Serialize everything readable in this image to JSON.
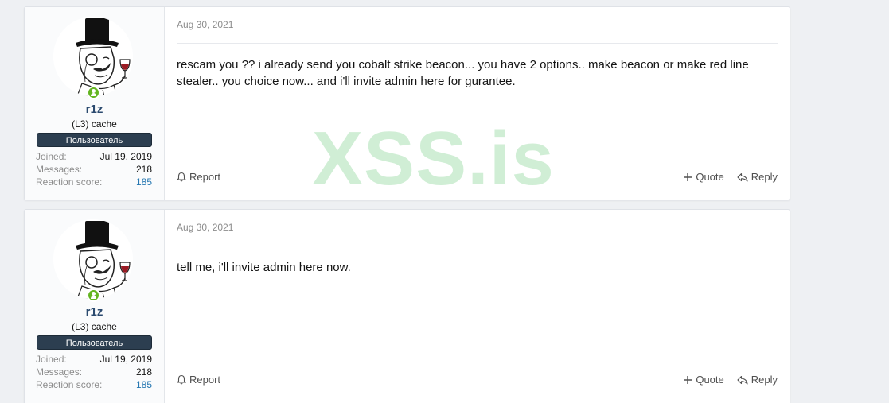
{
  "watermark": "XSS.is",
  "posts": [
    {
      "user": {
        "name": "r1z",
        "title": "(L3) cache",
        "banner": "Пользователь",
        "joined_label": "Joined:",
        "joined": "Jul 19, 2019",
        "messages_label": "Messages:",
        "messages": "218",
        "reaction_label": "Reaction score:",
        "reaction": "185"
      },
      "date": "Aug 30, 2021",
      "message": "rescam you ?? i already send you cobalt strike beacon... you have 2 options.. make beacon or make red line stealer.. you choice now... and i'll invite admin here for gurantee.",
      "actions": {
        "report": "Report",
        "quote": "Quote",
        "reply": "Reply"
      }
    },
    {
      "user": {
        "name": "r1z",
        "title": "(L3) cache",
        "banner": "Пользователь",
        "joined_label": "Joined:",
        "joined": "Jul 19, 2019",
        "messages_label": "Messages:",
        "messages": "218",
        "reaction_label": "Reaction score:",
        "reaction": "185"
      },
      "date": "Aug 30, 2021",
      "message": "tell me, i'll invite admin here now.",
      "actions": {
        "report": "Report",
        "quote": "Quote",
        "reply": "Reply"
      }
    }
  ],
  "colors": {
    "username": "#2b4a6f",
    "banner": "#2c3e50",
    "online": "#63b521",
    "watermark": "#59c46b",
    "link": "#2577b1"
  },
  "icons": {
    "online": "user-online-icon",
    "report": "bell-icon",
    "quote": "plus-icon",
    "reply": "reply-arrow-icon"
  }
}
